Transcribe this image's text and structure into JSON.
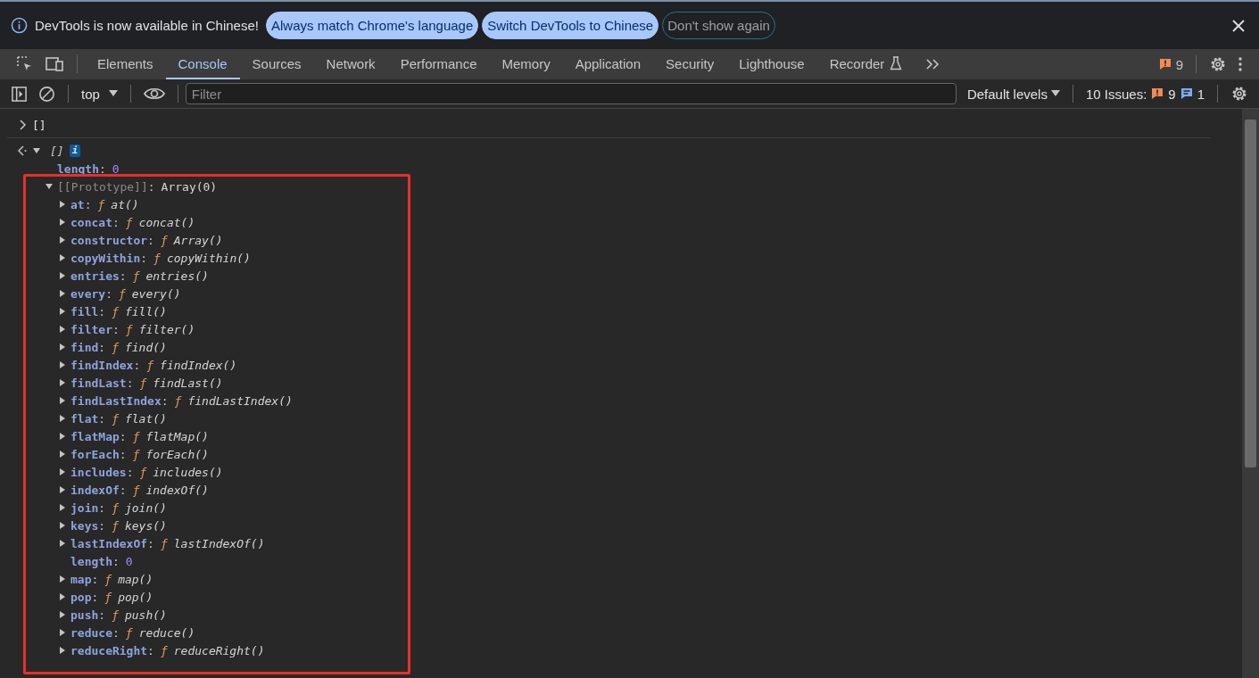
{
  "banner": {
    "message": "DevTools is now available in Chinese!",
    "buttons": [
      {
        "label": "Always match Chrome's language",
        "kind": "primary"
      },
      {
        "label": "Switch DevTools to Chinese",
        "kind": "primary"
      },
      {
        "label": "Don't show again",
        "kind": "outline"
      }
    ]
  },
  "tabs": [
    {
      "label": "Elements",
      "selected": false
    },
    {
      "label": "Console",
      "selected": true
    },
    {
      "label": "Sources",
      "selected": false
    },
    {
      "label": "Network",
      "selected": false
    },
    {
      "label": "Performance",
      "selected": false
    },
    {
      "label": "Memory",
      "selected": false
    },
    {
      "label": "Application",
      "selected": false
    },
    {
      "label": "Security",
      "selected": false
    },
    {
      "label": "Lighthouse",
      "selected": false
    },
    {
      "label": "Recorder",
      "selected": false,
      "experimental": true
    }
  ],
  "issues_count": "9",
  "console_toolbar": {
    "context": "top",
    "filter": {
      "placeholder": "Filter"
    },
    "levels": "Default levels",
    "issues_label": "10 Issues:",
    "warnings": "9",
    "infos": "1"
  },
  "entries": [
    {
      "kind": "input",
      "text": "[]"
    },
    {
      "kind": "result",
      "text": "[]",
      "badge": "i",
      "expanded": true,
      "children": [
        {
          "key": "length",
          "sep": ":",
          "value": "0",
          "kind": "number"
        },
        {
          "key": "[[Prototype]]",
          "sep": ":",
          "value": "Array(0)",
          "kind": "internal",
          "expanded": true,
          "children": [
            {
              "key": "at",
              "sep": ":",
              "sign": "ƒ",
              "value": "at()",
              "kind": "function",
              "expanded": false
            },
            {
              "key": "concat",
              "sep": ":",
              "sign": "ƒ",
              "value": "concat()",
              "kind": "function",
              "expanded": false
            },
            {
              "key": "constructor",
              "sep": ":",
              "sign": "ƒ",
              "value": "Array()",
              "kind": "function",
              "expanded": false
            },
            {
              "key": "copyWithin",
              "sep": ":",
              "sign": "ƒ",
              "value": "copyWithin()",
              "kind": "function",
              "expanded": false
            },
            {
              "key": "entries",
              "sep": ":",
              "sign": "ƒ",
              "value": "entries()",
              "kind": "function",
              "expanded": false
            },
            {
              "key": "every",
              "sep": ":",
              "sign": "ƒ",
              "value": "every()",
              "kind": "function",
              "expanded": false
            },
            {
              "key": "fill",
              "sep": ":",
              "sign": "ƒ",
              "value": "fill()",
              "kind": "function",
              "expanded": false
            },
            {
              "key": "filter",
              "sep": ":",
              "sign": "ƒ",
              "value": "filter()",
              "kind": "function",
              "expanded": false
            },
            {
              "key": "find",
              "sep": ":",
              "sign": "ƒ",
              "value": "find()",
              "kind": "function",
              "expanded": false
            },
            {
              "key": "findIndex",
              "sep": ":",
              "sign": "ƒ",
              "value": "findIndex()",
              "kind": "function",
              "expanded": false
            },
            {
              "key": "findLast",
              "sep": ":",
              "sign": "ƒ",
              "value": "findLast()",
              "kind": "function",
              "expanded": false
            },
            {
              "key": "findLastIndex",
              "sep": ":",
              "sign": "ƒ",
              "value": "findLastIndex()",
              "kind": "function",
              "expanded": false
            },
            {
              "key": "flat",
              "sep": ":",
              "sign": "ƒ",
              "value": "flat()",
              "kind": "function",
              "expanded": false
            },
            {
              "key": "flatMap",
              "sep": ":",
              "sign": "ƒ",
              "value": "flatMap()",
              "kind": "function",
              "expanded": false
            },
            {
              "key": "forEach",
              "sep": ":",
              "sign": "ƒ",
              "value": "forEach()",
              "kind": "function",
              "expanded": false
            },
            {
              "key": "includes",
              "sep": ":",
              "sign": "ƒ",
              "value": "includes()",
              "kind": "function",
              "expanded": false
            },
            {
              "key": "indexOf",
              "sep": ":",
              "sign": "ƒ",
              "value": "indexOf()",
              "kind": "function",
              "expanded": false
            },
            {
              "key": "join",
              "sep": ":",
              "sign": "ƒ",
              "value": "join()",
              "kind": "function",
              "expanded": false
            },
            {
              "key": "keys",
              "sep": ":",
              "sign": "ƒ",
              "value": "keys()",
              "kind": "function",
              "expanded": false
            },
            {
              "key": "lastIndexOf",
              "sep": ":",
              "sign": "ƒ",
              "value": "lastIndexOf()",
              "kind": "function",
              "expanded": false
            },
            {
              "key": "length",
              "sep": ":",
              "value": "0",
              "kind": "number"
            },
            {
              "key": "map",
              "sep": ":",
              "sign": "ƒ",
              "value": "map()",
              "kind": "function",
              "expanded": false
            },
            {
              "key": "pop",
              "sep": ":",
              "sign": "ƒ",
              "value": "pop()",
              "kind": "function",
              "expanded": false
            },
            {
              "key": "push",
              "sep": ":",
              "sign": "ƒ",
              "value": "push()",
              "kind": "function",
              "expanded": false
            },
            {
              "key": "reduce",
              "sep": ":",
              "sign": "ƒ",
              "value": "reduce()",
              "kind": "function",
              "expanded": false
            },
            {
              "key": "reduceRight",
              "sep": ":",
              "sign": "ƒ",
              "value": "reduceRight()",
              "kind": "function",
              "expanded": false
            }
          ]
        }
      ]
    }
  ]
}
